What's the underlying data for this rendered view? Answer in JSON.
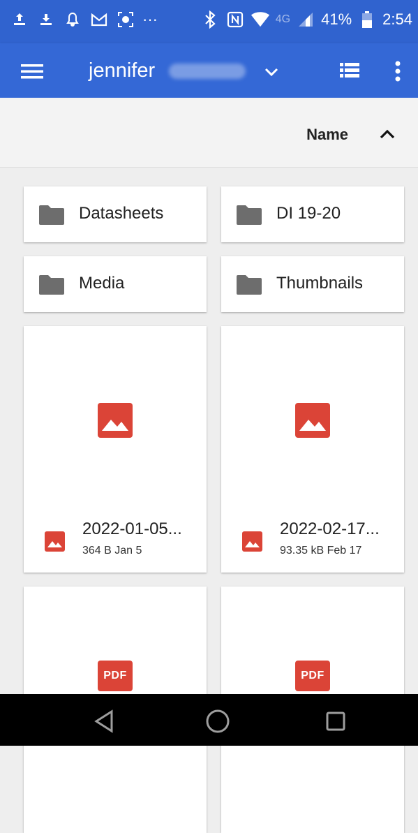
{
  "status_bar": {
    "icons": [
      "upload-notification-icon",
      "download-notification-icon",
      "bell-icon",
      "gmail-icon",
      "screen-record-icon",
      "more-notifications-icon",
      "bluetooth-icon",
      "nfc-icon",
      "wifi-icon",
      "lte-icon",
      "signal-icon",
      "battery-icon"
    ],
    "more": "···",
    "lte": "4G",
    "battery_percent": "41%",
    "time": "2:54"
  },
  "app_bar": {
    "account_name": "jennifer",
    "menu_icon": "hamburger-menu-icon",
    "dropdown_icon": "chevron-down-icon",
    "view_toggle_icon": "list-view-icon",
    "overflow_icon": "more-vert-icon",
    "color": "#3468d6"
  },
  "sort": {
    "label": "Name",
    "direction_icon": "arrow-up-icon"
  },
  "folders": [
    {
      "name": "Datasheets"
    },
    {
      "name": "DI 19-20"
    },
    {
      "name": "Media"
    },
    {
      "name": "Thumbnails"
    }
  ],
  "files": [
    {
      "name": "2022-01-05...",
      "meta": "364 B Jan 5",
      "type": "image"
    },
    {
      "name": "2022-02-17...",
      "meta": "93.35 kB Feb 17",
      "type": "image"
    },
    {
      "name": "",
      "meta": "",
      "type": "pdf",
      "badge": "PDF"
    },
    {
      "name": "",
      "meta": "",
      "type": "pdf",
      "badge": "PDF"
    }
  ],
  "nav_bar": {
    "back_icon": "back-triangle-icon",
    "home_icon": "home-circle-icon",
    "recents_icon": "recents-square-icon"
  },
  "colors": {
    "accent": "#3468d6",
    "file_red": "#db4437",
    "folder_grey": "#6d6d6d"
  }
}
